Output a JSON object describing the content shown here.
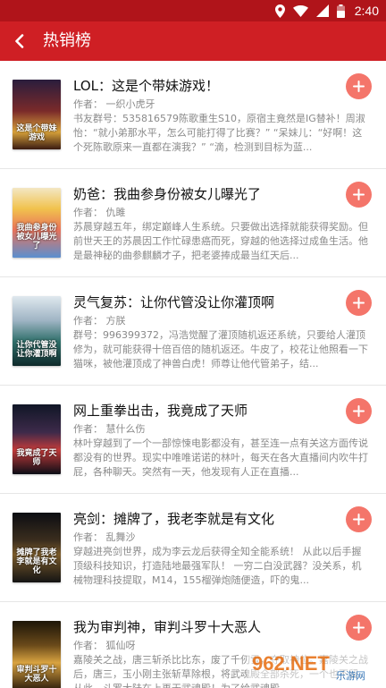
{
  "status_bar": {
    "time": "2:40"
  },
  "header": {
    "title": "热销榜"
  },
  "theme": {
    "primary": "#cf1f24",
    "status_bar": "#b0141a",
    "add_button": "#f4756a"
  },
  "books": [
    {
      "title": "LOL：这是个带妹游戏！",
      "author": "作者：  一织小虎牙",
      "description": "书友群号：535816579陈歌重生S10，原宿主竟然是IG替补！周淑怡：“就小弟那水平，怎么可能打得了比赛？” “呆妹儿：“好啊！这个死陈歌原来一直都在演我？” “滴，检测到目标为蓝...",
      "cover_text": "这是个带妹游戏"
    },
    {
      "title": "奶爸：我曲参身份被女儿曝光了",
      "author": "作者：  仇雎",
      "description": "苏晨穿越五年，绑定巅峰人生系统。只要做出选择就能获得奖励。但前世天王的苏晨因工作忙碌患癌而死，穿越的他选择过成鱼生活。他是最神秘的曲参麒麟才子，把老婆捧成最当红天后...",
      "cover_text": "我曲参身份被女儿曝光了"
    },
    {
      "title": "灵气复苏：让你代管没让你灌顶啊",
      "author": "作者：  方朕",
      "description": "群号：996399372，冯浩觉醒了灌顶随机返还系统，只要给人灌顶修为，就可能获得十倍百倍的随机返还。牛皮了，校花让他照看一下猫咪，被他灌顶成了神兽白虎！师尊让他代管弟子，结...",
      "cover_text": "让你代管没让你灌顶啊"
    },
    {
      "title": "网上重拳出击，我竟成了天师",
      "author": "作者：  慧什么伤",
      "description": "林叶穿越到了一个一部惊悚电影都没有，甚至连一点有关这方面传说都没有的世界。现实中唯唯诺诺的林叶，每天在各大直播间内吹牛打屁，各种聊天。突然有一天，他发现有人正在直播...",
      "cover_text": "我竟成了天师"
    },
    {
      "title": "亮剑：摊牌了，我老李就是有文化",
      "author": "作者：  乱舞沙",
      "description": "穿越进亮剑世界，成为李云龙后获得全知全能系统！  从此以后手握顶级科技知识，打造陆地最强军队！  一穷二白没武器？没关系，机械物理科技提取，M14，155榴弹炮随便造，吓的鬼...",
      "cover_text": "摊牌了我老李就是有文化"
    },
    {
      "title": "我为审判神，审判斗罗十大恶人",
      "author": "作者：  狐仙呀",
      "description": "嘉陵关之战，唐三斩杀比比东，废了千仞雪，夺取神位。嘉陵关之战后，唐三，玉小刚主张斩草除根，将武魂殿全部杀死，一个也不留。从此，斗罗大陆在上再无武魂殿！为了给武魂殿...",
      "cover_text": "审判斗罗十大恶人"
    }
  ],
  "watermark": {
    "text": "962.NET",
    "subtext": "乐游网"
  }
}
